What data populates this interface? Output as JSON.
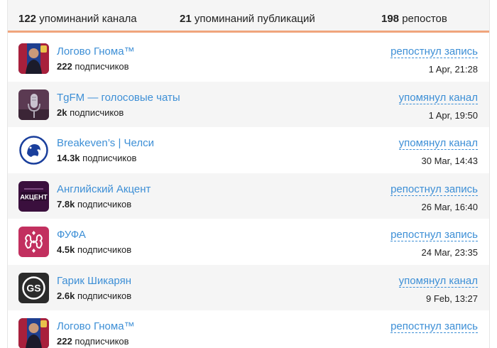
{
  "stats": {
    "channel_mentions_count": "122",
    "channel_mentions_label": "упоминаний канала",
    "post_mentions_count": "21",
    "post_mentions_label": "упоминаний публикаций",
    "reposts_count": "198",
    "reposts_label": "репостов"
  },
  "rows": [
    {
      "name": "Логово Гнома™",
      "subs_count": "222",
      "subs_label": "подписчиков",
      "action": "репостнул запись",
      "time": "1 Apr, 21:28",
      "avatar_icon": "gnome-channel-avatar"
    },
    {
      "name": "TgFM — голосовые чаты",
      "subs_count": "2k",
      "subs_label": "подписчиков",
      "action": "упомянул канал",
      "time": "1 Apr, 19:50",
      "avatar_icon": "microphone-avatar"
    },
    {
      "name": "Breakeven’s | Челси",
      "subs_count": "14.3k",
      "subs_label": "подписчиков",
      "action": "упомянул канал",
      "time": "30 Mar, 14:43",
      "avatar_icon": "chelsea-lion-avatar"
    },
    {
      "name": "Английский Акцент",
      "subs_count": "7.8k",
      "subs_label": "подписчиков",
      "action": "репостнул запись",
      "time": "26 Mar, 16:40",
      "avatar_icon": "akcent-logo-avatar",
      "avatar_text": "АКЦЕНТ"
    },
    {
      "name": "ФУФА",
      "subs_count": "4.5k",
      "subs_label": "подписчиков",
      "action": "репостнул запись",
      "time": "24 Mar, 23:35",
      "avatar_icon": "fufa-logo-avatar"
    },
    {
      "name": "Гарик Шикарян",
      "subs_count": "2.6k",
      "subs_label": "подписчиков",
      "action": "упомянул канал",
      "time": "9 Feb, 13:27",
      "avatar_icon": "gs-logo-avatar",
      "avatar_text": "GS"
    },
    {
      "name": "Логово Гнома™",
      "subs_count": "222",
      "subs_label": "подписчиков",
      "action": "репостнул запись",
      "time": "",
      "avatar_icon": "gnome-channel-avatar"
    }
  ]
}
